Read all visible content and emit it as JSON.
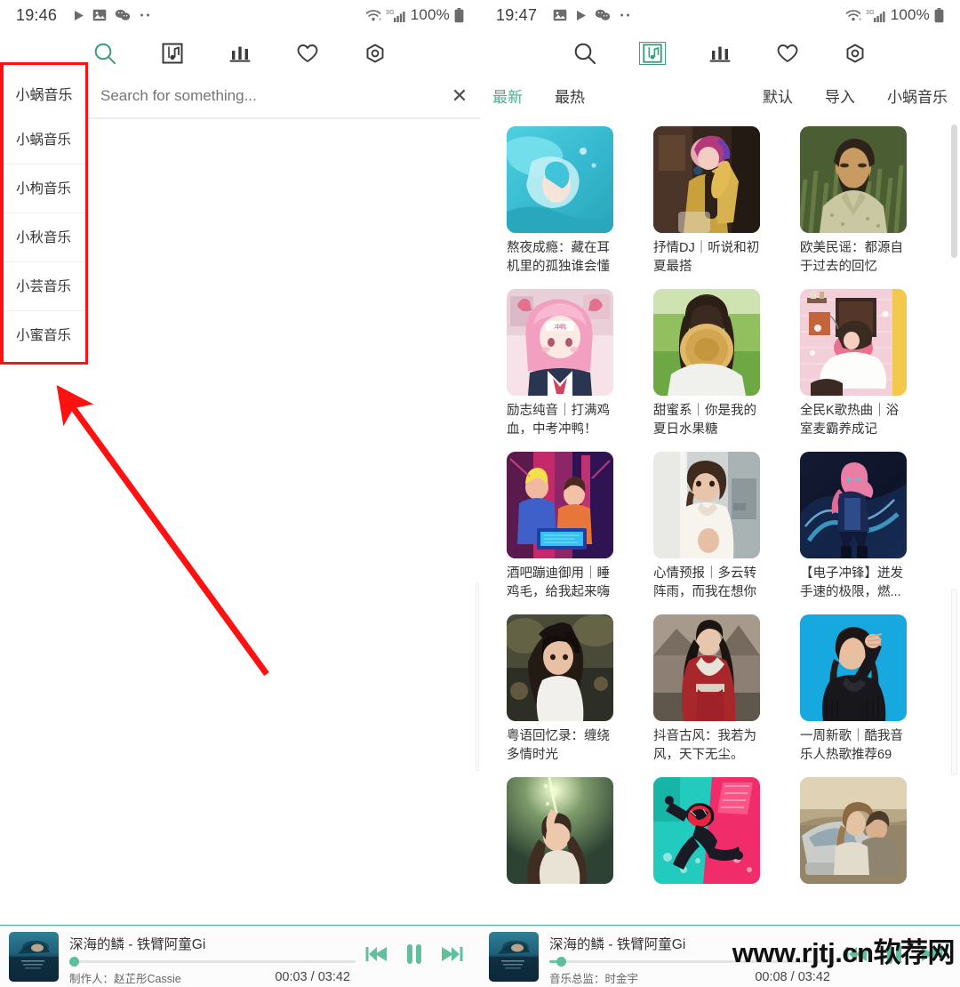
{
  "left": {
    "status": {
      "time": "19:46",
      "battery_pct": "100%",
      "network": "3G",
      "icons": [
        "play-icon",
        "image-icon",
        "wechat-icon",
        "more-icon"
      ]
    },
    "toolbar": {
      "icons": [
        "search-icon",
        "album-icon",
        "chart-icon",
        "heart-icon",
        "settings-icon"
      ],
      "active": "search-icon"
    },
    "search": {
      "label": "小蜗音乐",
      "placeholder": "Search for something...",
      "value": "",
      "close": "✕"
    },
    "dropdown": {
      "items": [
        "小蜗音乐",
        "小枸音乐",
        "小秋音乐",
        "小芸音乐",
        "小蜜音乐"
      ]
    },
    "player": {
      "title": "深海的鳞 - 铁臂阿童Gi",
      "subtitle": "制作人：赵芷彤Cassie",
      "time": "00:03 / 03:42",
      "progress_pct": 1.5,
      "controls": [
        "previous-icon",
        "pause-icon",
        "next-icon"
      ]
    }
  },
  "right": {
    "status": {
      "time": "19:47",
      "battery_pct": "100%",
      "network": "3G",
      "icons": [
        "image-icon",
        "play-icon",
        "wechat-icon",
        "more-icon"
      ]
    },
    "toolbar": {
      "icons": [
        "search-icon",
        "album-icon",
        "chart-icon",
        "heart-icon",
        "settings-icon"
      ],
      "active": "album-icon"
    },
    "tabs_left": [
      {
        "label": "最新",
        "active": true
      },
      {
        "label": "最热",
        "active": false
      }
    ],
    "tabs_right": [
      {
        "label": "默认",
        "active": false
      },
      {
        "label": "导入",
        "active": false
      },
      {
        "label": "小蜗音乐",
        "active": false
      }
    ],
    "cards": [
      {
        "title": "熬夜成瘾：藏在耳机里的孤独谁会懂",
        "art": "anime-underwater-blue"
      },
      {
        "title": "抒情DJ｜听说和初夏最搭",
        "art": "photo-woman-sax"
      },
      {
        "title": "欧美民谣：都源自于过去的回忆",
        "art": "illus-bearded-man-green"
      },
      {
        "title": "励志纯音｜打满鸡血，中考冲鸭！",
        "art": "anime-pink-girl"
      },
      {
        "title": "甜蜜系｜你是我的夏日水果糖",
        "art": "photo-girl-hat-field"
      },
      {
        "title": "全民K歌热曲｜浴室麦霸养成记",
        "art": "illus-bathroom-singer"
      },
      {
        "title": "酒吧蹦迪御用｜睡鸡毛，给我起来嗨",
        "art": "photo-dj-neon"
      },
      {
        "title": "心情预报｜多云转阵雨，而我在想你",
        "art": "photo-woman-window"
      },
      {
        "title": "【电子冲锋】迸发手速的极限，燃...",
        "art": "anime-dark-pink-hair"
      },
      {
        "title": "粤语回忆录：缠绕多情时光",
        "art": "photo-woman-sunset"
      },
      {
        "title": "抖音古风：我若为风，天下无尘。",
        "art": "photo-hanfu-red"
      },
      {
        "title": "一周新歌｜酷我音乐人热歌推荐69",
        "art": "photo-woman-blue-bg"
      },
      {
        "title": "",
        "art": "photo-woman-green-light"
      },
      {
        "title": "",
        "art": "illus-spiderman-teal"
      },
      {
        "title": "",
        "art": "photo-couple-car"
      }
    ],
    "player": {
      "title": "深海的鳞 - 铁臂阿童Gi",
      "subtitle": "音乐总监：时金宇",
      "time": "00:08 / 03:42",
      "progress_pct": 3.6,
      "controls": [
        "previous-icon",
        "pause-icon",
        "next-icon"
      ]
    }
  },
  "annotation": {
    "type": "red-box-and-arrow",
    "color": "#ff1111"
  },
  "watermark": {
    "text": "www.rjtj.cn软荐网"
  },
  "colors": {
    "accent": "#49b08c",
    "accent_dark": "#3d9b7e",
    "text": "#333333",
    "muted": "#9a9a9a",
    "annotation": "#ff1111"
  }
}
